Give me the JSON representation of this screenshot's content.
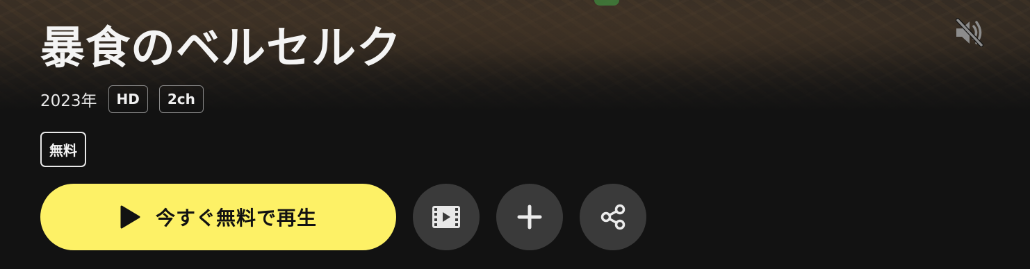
{
  "title": {
    "text": "暴食のベルセルク"
  },
  "meta": {
    "year": "2023年",
    "tags": [
      "HD",
      "2ch"
    ]
  },
  "badge": {
    "free": "無料"
  },
  "actions": {
    "play_label": "今すぐ無料で再生",
    "play_color": "#fdf166",
    "icons": {
      "play": "play-icon",
      "trailer": "film-icon",
      "add": "plus-icon",
      "share": "share-icon",
      "mute": "volume-muted-icon"
    }
  }
}
